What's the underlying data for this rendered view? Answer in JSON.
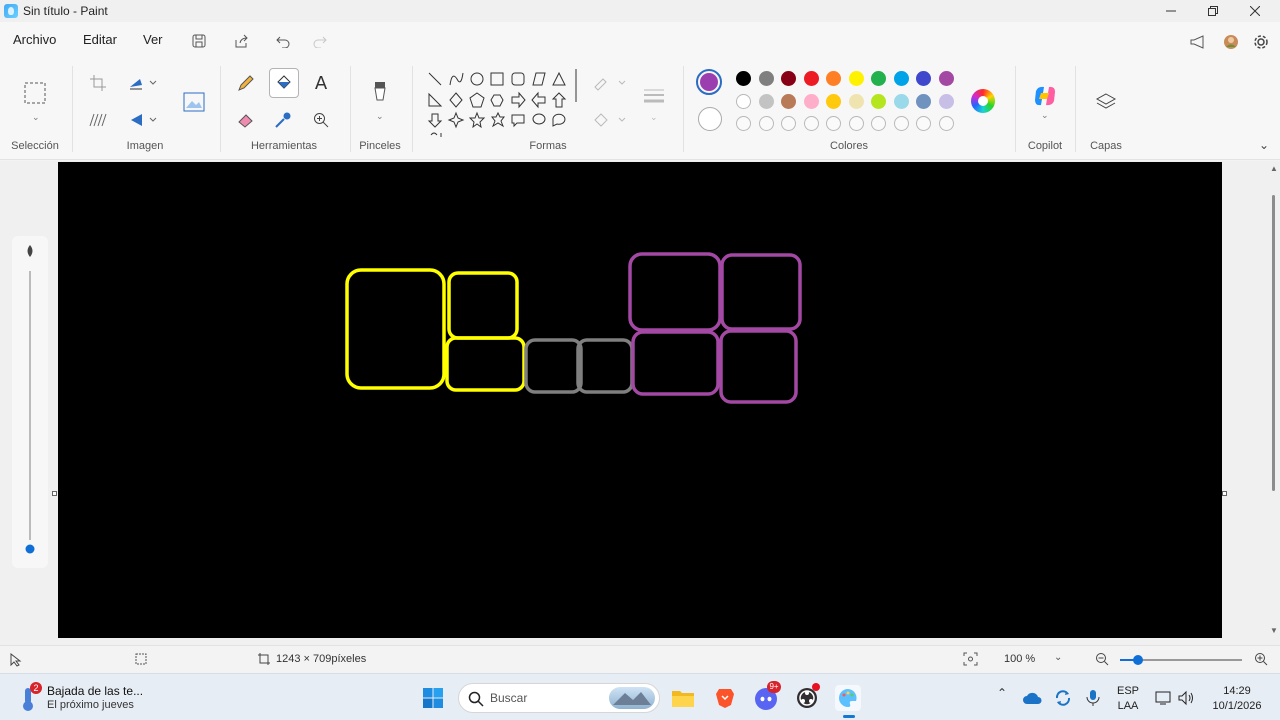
{
  "window": {
    "title": "Sin título - Paint",
    "controls": [
      "minimize",
      "maximize",
      "close"
    ]
  },
  "menu": {
    "items": [
      "Archivo",
      "Editar",
      "Ver"
    ],
    "quick_actions": [
      "save-icon",
      "share-icon",
      "undo-icon",
      "redo-icon"
    ]
  },
  "ribbon": {
    "groups": {
      "seleccion": "Selección",
      "imagen": "Imagen",
      "herramientas": "Herramientas",
      "pinceles": "Pinceles",
      "formas": "Formas",
      "colores": "Colores",
      "copilot": "Copilot",
      "capas": "Capas"
    },
    "active_tool": "fill-bucket",
    "text_tool_glyph": "A",
    "primary_color": "#9b3fb0",
    "secondary_color": "#ffffff",
    "palette_row1": [
      "#000000",
      "#7f7f7f",
      "#880015",
      "#ed1c24",
      "#ff7f27",
      "#fff200",
      "#22b14c",
      "#00a2e8",
      "#3f48cc",
      "#a349a4"
    ],
    "palette_row2": [
      "#ffffff",
      "#c3c3c3",
      "#b97a57",
      "#ffaec9",
      "#ffc90e",
      "#efe4b0",
      "#b5e61d",
      "#99d9ea",
      "#7092be",
      "#c8bfe7"
    ]
  },
  "canvas": {
    "background": "#000000",
    "stroke_colors": {
      "yellow": "#ffff00",
      "gray": "#7f7f7f",
      "purple": "#a349a4"
    }
  },
  "status": {
    "canvas_size": "1243 × 709píxeles",
    "zoom": "100 %"
  },
  "taskbar": {
    "notification": {
      "badge": "2",
      "title": "Bajada de las te...",
      "subtitle": "El próximo jueves"
    },
    "search_placeholder": "Buscar",
    "tray": {
      "lang": "ESP",
      "layout": "LAA",
      "time": "14:29",
      "date": "10/1/2026",
      "discord_badge": "9+"
    }
  }
}
